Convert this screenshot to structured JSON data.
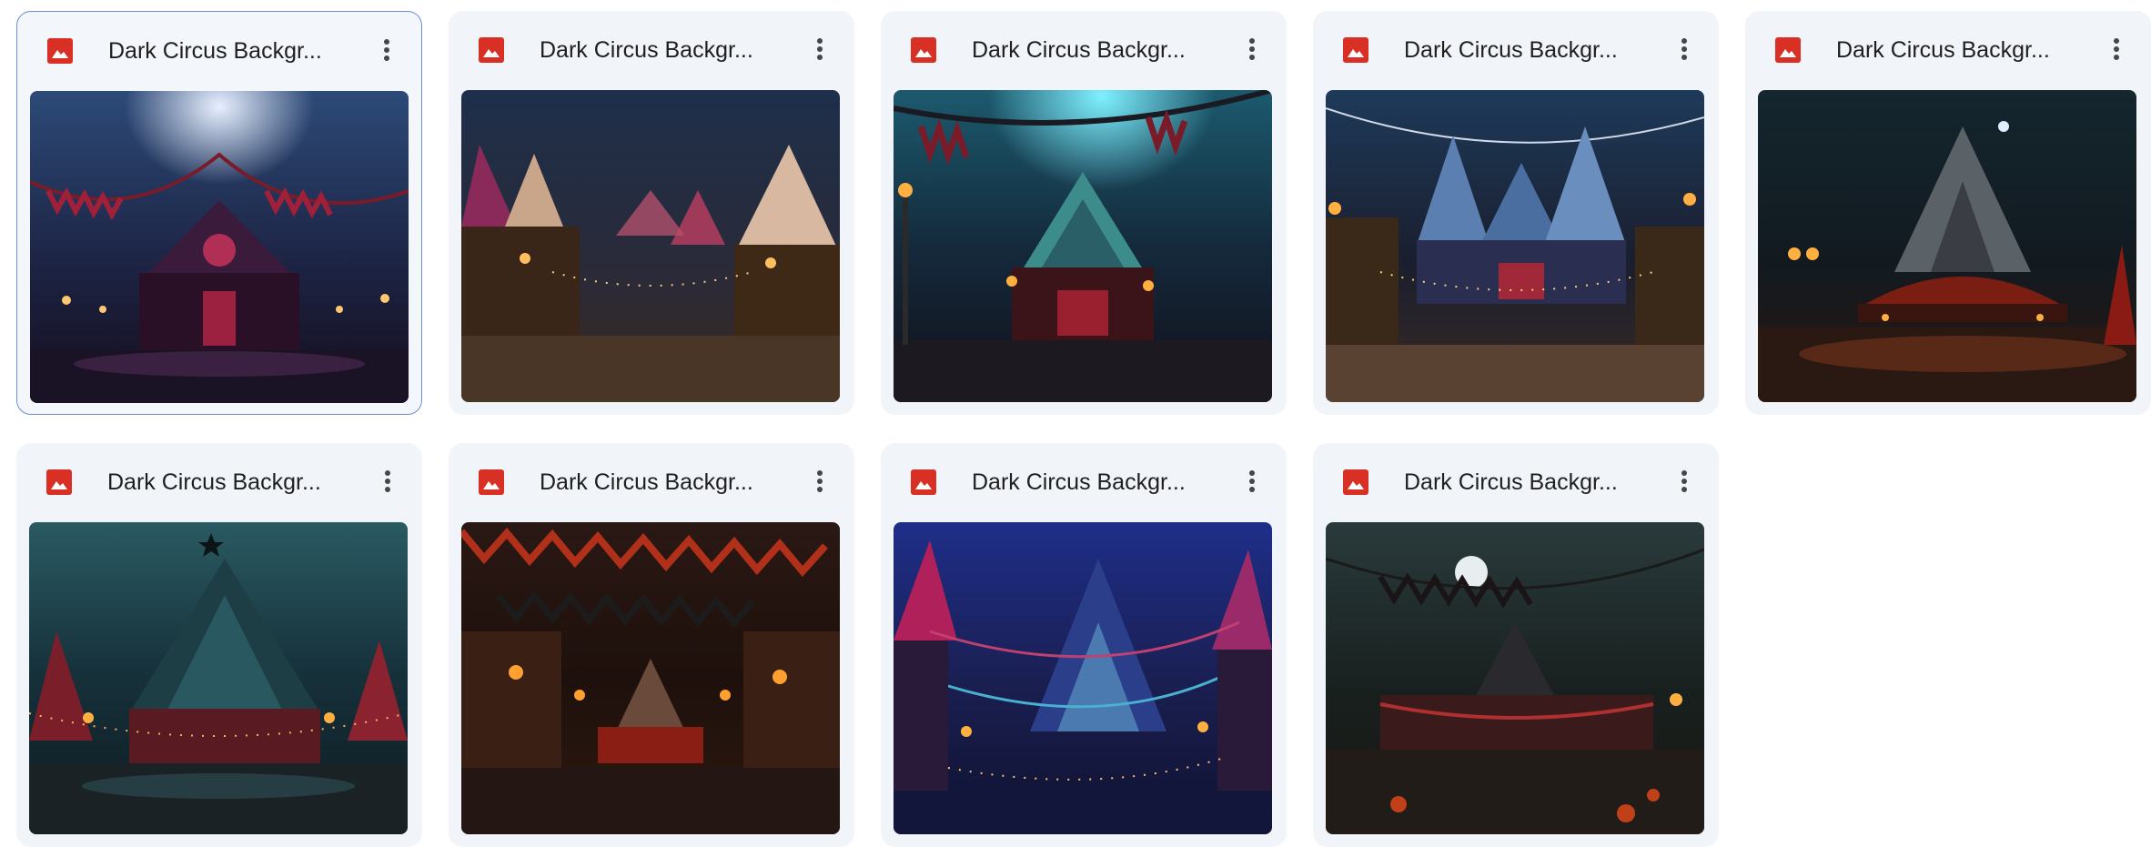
{
  "files": [
    {
      "name": "Dark Circus Backgr...",
      "selected": true,
      "thumb_theme": "blue-purple big-top with crimson pennants"
    },
    {
      "name": "Dark Circus Backgr...",
      "selected": false,
      "thumb_theme": "striped tents along a lantern lit path"
    },
    {
      "name": "Dark Circus Backgr...",
      "selected": false,
      "thumb_theme": "teal tent under moonlight"
    },
    {
      "name": "Dark Circus Backgr...",
      "selected": false,
      "thumb_theme": "blue spires with string lights"
    },
    {
      "name": "Dark Circus Backgr...",
      "selected": false,
      "thumb_theme": "lone dark tent with orange glow"
    },
    {
      "name": "Dark Circus Backgr...",
      "selected": false,
      "thumb_theme": "teal big-top with star on top"
    },
    {
      "name": "Dark Circus Backgr...",
      "selected": false,
      "thumb_theme": "black pennants over red lanterns"
    },
    {
      "name": "Dark Circus Backgr...",
      "selected": false,
      "thumb_theme": "neon blue tents with garlands"
    },
    {
      "name": "Dark Circus Backgr...",
      "selected": false,
      "thumb_theme": "full moon over circus with pumpkins"
    }
  ],
  "icons": {
    "file_type": "image-file-icon",
    "more": "more-vert-icon"
  },
  "colors": {
    "card_bg": "#f1f4f9",
    "selected_border": "#6b8fd6",
    "image_icon_red": "#d93025",
    "text": "#1f1f1f"
  }
}
